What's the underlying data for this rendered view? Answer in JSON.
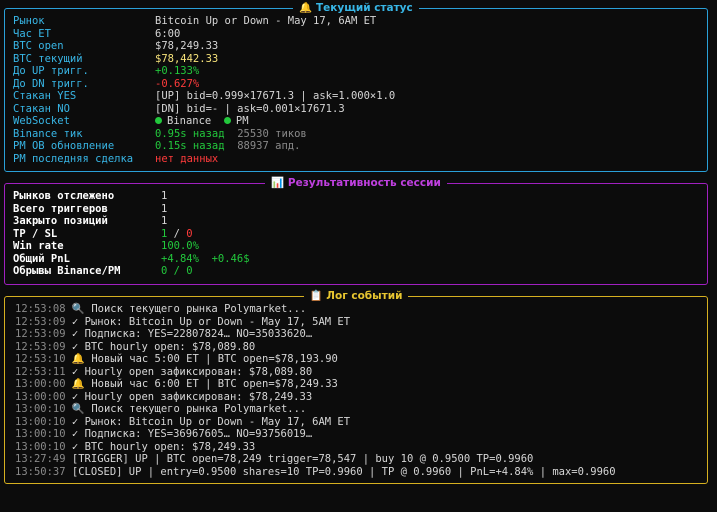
{
  "colors": {
    "status_border": "#2aa0d8",
    "session_border": "#a020c0",
    "log_border": "#d6b020"
  },
  "status": {
    "title": "Текущий статус",
    "icon": "bell-icon",
    "market_label": "Рынок",
    "market_value": "Bitcoin Up or Down - May 17, 6AM ET",
    "hour_label": "Час ET",
    "hour_value": "6:00",
    "open_label": "BTC open",
    "open_value": "$78,249.33",
    "current_label": "BTC текущий",
    "current_value": "$78,442.33",
    "up_label": "До UP тригг.",
    "up_value": "+0.133%",
    "dn_label": "До DN тригг.",
    "dn_value": "-0.627%",
    "yes_label": "Стакан YES",
    "yes_value": "[UP] bid=0.999×17671.3 | ask=1.000×1.0",
    "no_label": "Стакан NO",
    "no_value": "[DN] bid=- | ask=0.001×17671.3",
    "ws_label": "WebSocket",
    "ws_binance": "Binance",
    "ws_pm": "PM",
    "tick_label": "Binance тик",
    "tick_age": "0.95s назад",
    "tick_count": "25530 тиков",
    "ob_label": "PM OB обновление",
    "ob_age": "0.15s назад",
    "ob_count": "88937 апд.",
    "trade_label": "PM последняя сделка",
    "trade_value": "нет данных"
  },
  "session": {
    "title": "Результативность сессии",
    "icon": "chart-icon",
    "markets_label": "Рынков отслежено",
    "markets_value": "1",
    "triggers_label": "Всего триггеров",
    "triggers_value": "1",
    "closed_label": "Закрыто позиций",
    "closed_value": "1",
    "tpsl_label": "TP / SL",
    "tp_value": "1",
    "tpsl_sep": " / ",
    "sl_value": "0",
    "winrate_label": "Win rate",
    "winrate_value": "100.0%",
    "pnl_label": "Общий PnL",
    "pnl_pct": "+4.84%",
    "pnl_usd": "+0.46$",
    "breaks_label": "Обрывы Binance/PM",
    "breaks_value": "0 / 0"
  },
  "log": {
    "title": "Лог событий",
    "icon": "clipboard-icon",
    "entries": [
      {
        "t": "12:53:08",
        "icon": "🔍",
        "m": "Поиск текущего рынка Polymarket..."
      },
      {
        "t": "12:53:09",
        "icon": "✓",
        "m": "Рынок: Bitcoin Up or Down - May 17, 5AM ET"
      },
      {
        "t": "12:53:09",
        "icon": "✓",
        "m": "Подписка: YES=22807824… NO=35033620…"
      },
      {
        "t": "12:53:09",
        "icon": "✓",
        "m": "BTC hourly open: $78,089.80"
      },
      {
        "t": "12:53:10",
        "icon": "🔔",
        "m": "Новый час 5:00 ET | BTC open=$78,193.90"
      },
      {
        "t": "12:53:11",
        "icon": "✓",
        "m": "Hourly open зафиксирован: $78,089.80"
      },
      {
        "t": "13:00:00",
        "icon": "🔔",
        "m": "Новый час 6:00 ET | BTC open=$78,249.33"
      },
      {
        "t": "13:00:00",
        "icon": "✓",
        "m": "Hourly open зафиксирован: $78,249.33"
      },
      {
        "t": "13:00:10",
        "icon": "🔍",
        "m": "Поиск текущего рынка Polymarket..."
      },
      {
        "t": "13:00:10",
        "icon": "✓",
        "m": "Рынок: Bitcoin Up or Down - May 17, 6AM ET"
      },
      {
        "t": "13:00:10",
        "icon": "✓",
        "m": "Подписка: YES=36967605… NO=93756019…"
      },
      {
        "t": "13:00:10",
        "icon": "✓",
        "m": "BTC hourly open: $78,249.33"
      },
      {
        "t": "13:27:49",
        "icon": "",
        "m": "[TRIGGER] UP | BTC open=78,249 trigger=78,547 | buy 10 @ 0.9500 TP=0.9960"
      },
      {
        "t": "13:50:37",
        "icon": "",
        "m": "[CLOSED] UP | entry=0.9500 shares=10 TP=0.9960 | TP @ 0.9960 | PnL=+4.84% | max=0.9960"
      }
    ]
  }
}
